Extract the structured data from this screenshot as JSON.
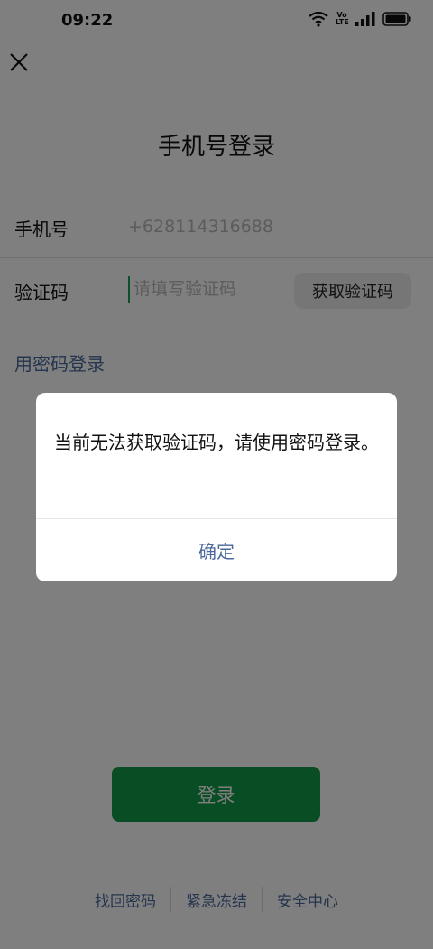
{
  "status_bar": {
    "time": "09:22",
    "volte_label": "Vo\nLTE",
    "icons": [
      "wifi-icon",
      "volte-icon",
      "signal-icon",
      "battery-icon"
    ]
  },
  "header": {
    "close_icon": "close-icon",
    "title": "手机号登录"
  },
  "form": {
    "phone_label": "手机号",
    "phone_value": "+628114316688",
    "code_label": "验证码",
    "code_placeholder": "请填写验证码",
    "get_code_label": "获取验证码"
  },
  "password_login_link": "用密码登录",
  "login_button_label": "登录",
  "bottom_links": [
    "找回密码",
    "紧急冻结",
    "安全中心"
  ],
  "dialog": {
    "message": "当前无法获取验证码，请使用密码登录。",
    "confirm_label": "确定"
  },
  "colors": {
    "accent_green": "#129a4b",
    "link_blue": "#4a6a9c",
    "overlay": "rgba(0,0,0,0.5)"
  }
}
